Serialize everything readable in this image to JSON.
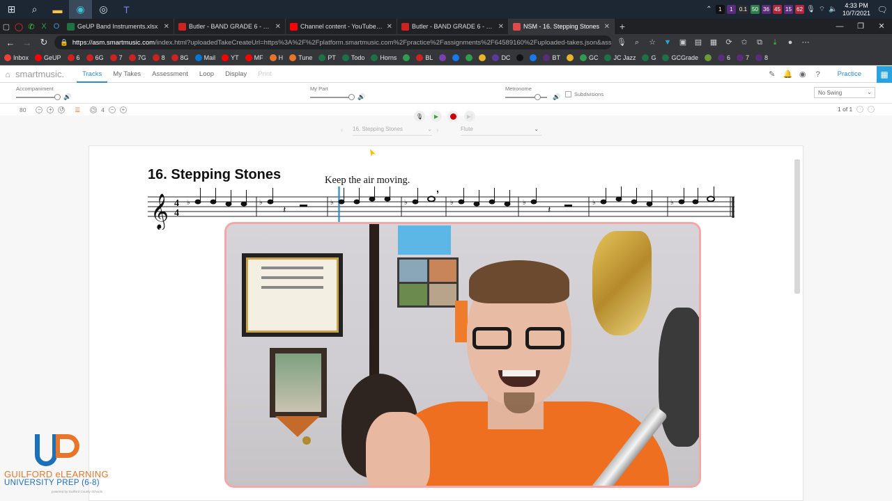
{
  "taskbar": {
    "apps": [
      "windows-icon",
      "search-icon",
      "file-explorer-icon",
      "edge-icon",
      "chrome-icon",
      "teams-icon"
    ],
    "tray_indicators": [
      {
        "label": "1",
        "color": "#111111"
      },
      {
        "label": "1",
        "color": "#5a2d7a"
      },
      {
        "label": "0.1",
        "color": "#2a2a2a"
      },
      {
        "label": "50",
        "color": "#2e7d4f"
      },
      {
        "label": "36",
        "color": "#5a2d7a"
      },
      {
        "label": "45",
        "color": "#b0263a"
      },
      {
        "label": "15",
        "color": "#5a2d7a"
      },
      {
        "label": "62",
        "color": "#b0263a"
      }
    ],
    "time": "4:33 PM",
    "date": "10/7/2021"
  },
  "browser": {
    "tabs": [
      {
        "title": "GeUP Band Instruments.xlsx",
        "color": "#1e7145",
        "active": false
      },
      {
        "title": "Butler - BAND GRADE 6 - 6(A)",
        "color": "#cc2222",
        "active": false
      },
      {
        "title": "Channel content - YouTube Studio",
        "color": "#ff0000",
        "active": false
      },
      {
        "title": "Butler - BAND GRADE 6 - 6(A)",
        "color": "#cc2222",
        "active": false
      },
      {
        "title": "NSM - 16. Stepping Stones",
        "color": "#e04a4a",
        "active": true
      }
    ],
    "url_host": "https://asm.smartmusic.com",
    "url_path": "/index.html?uploadedTakeCreateUrl=https%3A%2F%2Fplatform.smartmusic.com%2Fpractice%2Fassignments%2F64589160%2Fuploaded-takes.json&assign...",
    "bookmarks": [
      {
        "label": "Inbox",
        "color": "#ea4335"
      },
      {
        "label": "GeUP",
        "color": "#ff0000"
      },
      {
        "label": "6",
        "color": "#cc2222"
      },
      {
        "label": "6G",
        "color": "#cc2222"
      },
      {
        "label": "7",
        "color": "#cc2222"
      },
      {
        "label": "7G",
        "color": "#cc2222"
      },
      {
        "label": "8",
        "color": "#cc2222"
      },
      {
        "label": "8G",
        "color": "#cc2222"
      },
      {
        "label": "Mail",
        "color": "#0078d4"
      },
      {
        "label": "YT",
        "color": "#ff0000"
      },
      {
        "label": "MF",
        "color": "#ff0000"
      },
      {
        "label": "H",
        "color": "#e8762a"
      },
      {
        "label": "Tune",
        "color": "#e8762a"
      },
      {
        "label": "PT",
        "color": "#1e7145"
      },
      {
        "label": "Todo",
        "color": "#1e7145"
      },
      {
        "label": "Horns",
        "color": "#1e7145"
      },
      {
        "label": "",
        "color": "#2e9c4f"
      },
      {
        "label": "BL",
        "color": "#cc2222"
      },
      {
        "label": "",
        "color": "#7b3fb0"
      },
      {
        "label": "",
        "color": "#1877f2"
      },
      {
        "label": "",
        "color": "#2e9c4f"
      },
      {
        "label": "",
        "color": "#e8b42a"
      },
      {
        "label": "DC",
        "color": "#5a3aa0"
      },
      {
        "label": "",
        "color": "#111111"
      },
      {
        "label": "",
        "color": "#1877f2"
      },
      {
        "label": "BT",
        "color": "#5a2d7a"
      },
      {
        "label": "",
        "color": "#e8b42a"
      },
      {
        "label": "GC",
        "color": "#2e9c4f"
      },
      {
        "label": "JC Jazz",
        "color": "#1e7145"
      },
      {
        "label": "G",
        "color": "#1e7145"
      },
      {
        "label": "GCGrade",
        "color": "#1e7145"
      },
      {
        "label": "",
        "color": "#6a9a3a"
      },
      {
        "label": "6",
        "color": "#5a2d7a"
      },
      {
        "label": "7",
        "color": "#5a2d7a"
      },
      {
        "label": "8",
        "color": "#5a2d7a"
      }
    ]
  },
  "smartmusic": {
    "logo": "smartmusic.",
    "nav": [
      "Tracks",
      "My Takes",
      "Assessment",
      "Loop",
      "Display",
      "Print"
    ],
    "active_nav": "Tracks",
    "practice_label": "Practice",
    "mixer": {
      "accompaniment_label": "Accompaniment",
      "accompaniment_level": 1.0,
      "my_part_label": "My Part",
      "my_part_level": 1.0,
      "metronome_label": "Metronome",
      "metronome_level": 0.7,
      "subdivisions_label": "Subdivisions",
      "swing_value": "No Swing"
    },
    "tempo": "80",
    "count_in": "4",
    "page_indicator": "1 of 1",
    "title_select": "16. Stepping Stones",
    "instrument_select": "Flute",
    "colors": {
      "accent": "#2a8bc7",
      "record": "#cc0000",
      "play": "#3aa33a",
      "volume": "#e8762a"
    }
  },
  "score": {
    "title": "16. Stepping Stones",
    "expression": "Keep the air moving.",
    "time_signature_top": "4",
    "time_signature_bottom": "4"
  },
  "logo": {
    "line1": "GUILFORD eLEARNING",
    "line2": "UNIVERSITY PREP (6-8)",
    "line3": "powered by Guilford County Schools"
  }
}
